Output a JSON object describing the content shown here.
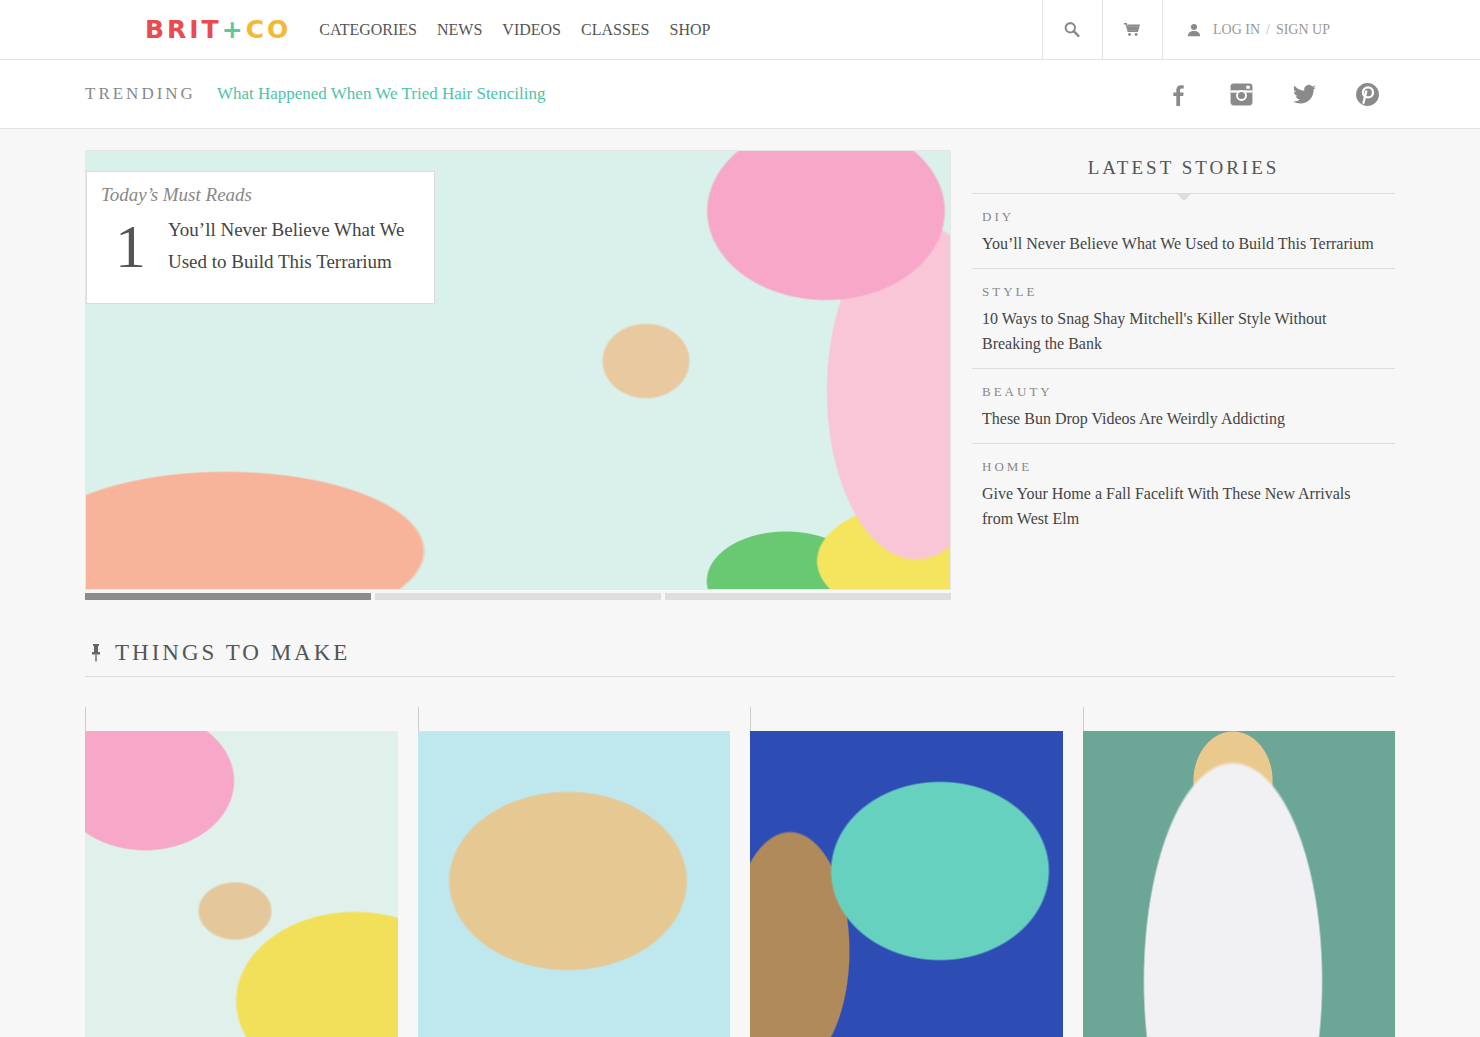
{
  "logo": [
    {
      "text": "BRIT",
      "color": "#e94b4f"
    },
    {
      "text": "+",
      "color": "#5cc7a4"
    },
    {
      "text": "CO",
      "color": "#f4b835"
    }
  ],
  "nav": [
    "CATEGORIES",
    "NEWS",
    "VIDEOS",
    "CLASSES",
    "SHOP"
  ],
  "account": {
    "login": "LOG IN",
    "separator": "/",
    "signup": "SIGN UP"
  },
  "trending": {
    "label": "TRENDING",
    "link": "What Happened When We Tried Hair Stenciling"
  },
  "hero": {
    "kicker": "Today’s Must Reads",
    "number": "1",
    "title": "You’ll Never Believe What We Used to Build This Terrarium",
    "slides": [
      {
        "selected": true
      },
      {
        "selected": false
      },
      {
        "selected": false
      }
    ]
  },
  "latest": {
    "title": "LATEST STORIES",
    "stories": [
      {
        "category": "DIY",
        "title": "You’ll Never Believe What We Used to Build This Terrarium"
      },
      {
        "category": "STYLE",
        "title": "10 Ways to Snag Shay Mitchell's Killer Style Without Breaking the Bank"
      },
      {
        "category": "BEAUTY",
        "title": "These Bun Drop Videos Are Weirdly Addicting"
      },
      {
        "category": "HOME",
        "title": "Give Your Home a Fall Facelift With These New Arrivals from West Elm"
      }
    ]
  },
  "section": {
    "title": "THINGS TO MAKE"
  }
}
